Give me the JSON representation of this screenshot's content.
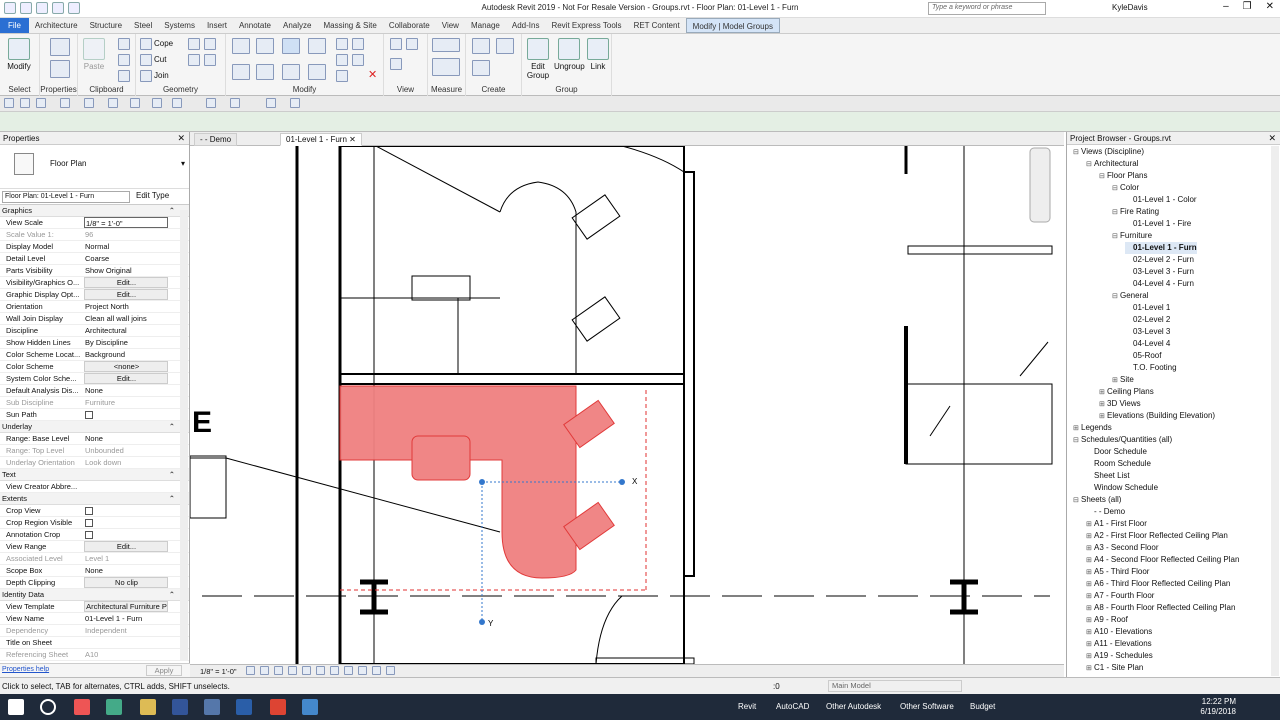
{
  "window": {
    "title": "Autodesk Revit 2019 - Not For Resale Version - Groups.rvt - Floor Plan: 01-Level 1 - Furn",
    "search_placeholder": "Type a keyword or phrase",
    "user": "KyleDavis"
  },
  "ribbon_tabs": [
    "File",
    "Architecture",
    "Structure",
    "Steel",
    "Systems",
    "Insert",
    "Annotate",
    "Analyze",
    "Massing & Site",
    "Collaborate",
    "View",
    "Manage",
    "Add-Ins",
    "Revit Express Tools",
    "RET Content",
    "Modify | Model Groups"
  ],
  "ribbon": {
    "modify_label": "Modify",
    "paste_label": "Paste",
    "cope_label": "Cope",
    "cut_label": "Cut",
    "join_label": "Join",
    "edit_group_label": "Edit Group",
    "ungroup_label": "Ungroup",
    "link_label": "Link",
    "panels": [
      "Select",
      "Properties",
      "Clipboard",
      "Geometry",
      "Modify",
      "View",
      "Measure",
      "Create",
      "Group"
    ]
  },
  "properties": {
    "header": "Properties",
    "type_name": "Floor Plan",
    "selector": "Floor Plan: 01-Level 1 - Furn",
    "edit_type": "Edit Type",
    "rows": [
      {
        "kind": "section",
        "label": "Graphics"
      },
      {
        "k": "View Scale",
        "v": "1/8\" = 1'-0\"",
        "style": "input"
      },
      {
        "k": "Scale Value   1:",
        "v": "96",
        "style": "grey"
      },
      {
        "k": "Display Model",
        "v": "Normal"
      },
      {
        "k": "Detail Level",
        "v": "Coarse"
      },
      {
        "k": "Parts Visibility",
        "v": "Show Original"
      },
      {
        "k": "Visibility/Graphics O...",
        "v": "Edit...",
        "style": "btn"
      },
      {
        "k": "Graphic Display Opt...",
        "v": "Edit...",
        "style": "btn"
      },
      {
        "k": "Orientation",
        "v": "Project North"
      },
      {
        "k": "Wall Join Display",
        "v": "Clean all wall joins"
      },
      {
        "k": "Discipline",
        "v": "Architectural"
      },
      {
        "k": "Show Hidden Lines",
        "v": "By Discipline"
      },
      {
        "k": "Color Scheme Locat...",
        "v": "Background"
      },
      {
        "k": "Color Scheme",
        "v": "<none>",
        "style": "btn"
      },
      {
        "k": "System Color Sche...",
        "v": "Edit...",
        "style": "btn"
      },
      {
        "k": "Default Analysis Dis...",
        "v": "None"
      },
      {
        "k": "Sub Discipline",
        "v": "Furniture",
        "style": "grey"
      },
      {
        "k": "Sun Path",
        "v": "",
        "style": "check"
      },
      {
        "kind": "section",
        "label": "Underlay"
      },
      {
        "k": "Range: Base Level",
        "v": "None"
      },
      {
        "k": "Range: Top Level",
        "v": "Unbounded",
        "style": "grey"
      },
      {
        "k": "Underlay Orientation",
        "v": "Look down",
        "style": "grey"
      },
      {
        "kind": "section",
        "label": "Text"
      },
      {
        "k": "View Creator Abbre...",
        "v": ""
      },
      {
        "kind": "section",
        "label": "Extents"
      },
      {
        "k": "Crop View",
        "v": "",
        "style": "check"
      },
      {
        "k": "Crop Region Visible",
        "v": "",
        "style": "check"
      },
      {
        "k": "Annotation Crop",
        "v": "",
        "style": "check"
      },
      {
        "k": "View Range",
        "v": "Edit...",
        "style": "btn"
      },
      {
        "k": "Associated Level",
        "v": "Level 1",
        "style": "grey"
      },
      {
        "k": "Scope Box",
        "v": "None"
      },
      {
        "k": "Depth Clipping",
        "v": "No clip",
        "style": "btn"
      },
      {
        "kind": "section",
        "label": "Identity Data"
      },
      {
        "k": "View Template",
        "v": "Architectural Furniture P",
        "style": "btn"
      },
      {
        "k": "View Name",
        "v": "01-Level 1 - Furn"
      },
      {
        "k": "Dependency",
        "v": "Independent",
        "style": "grey"
      },
      {
        "k": "Title on Sheet",
        "v": ""
      },
      {
        "k": "Referencing Sheet",
        "v": "A10",
        "style": "grey"
      }
    ],
    "help_link": "Properties help",
    "apply": "Apply"
  },
  "view_tabs": [
    {
      "label": "- - Demo",
      "active": false
    },
    {
      "label": "01-Level 1 - Furn",
      "active": true
    }
  ],
  "canvas": {
    "x_label": "X",
    "y_label": "Y",
    "e_label": "E"
  },
  "view_control": {
    "scale": "1/8\" = 1'-0\""
  },
  "browser": {
    "header": "Project Browser - Groups.rvt",
    "items": [
      {
        "label": "Views (Discipline)",
        "indent": 0,
        "tw": "⊟"
      },
      {
        "label": "Architectural",
        "indent": 1,
        "tw": "⊟"
      },
      {
        "label": "Floor Plans",
        "indent": 2,
        "tw": "⊟"
      },
      {
        "label": "Color",
        "indent": 3,
        "tw": "⊟"
      },
      {
        "label": "01-Level 1 - Color",
        "indent": 4,
        "tw": ""
      },
      {
        "label": "Fire Rating",
        "indent": 3,
        "tw": "⊟"
      },
      {
        "label": "01-Level 1 - Fire",
        "indent": 4,
        "tw": ""
      },
      {
        "label": "Furniture",
        "indent": 3,
        "tw": "⊟"
      },
      {
        "label": "01-Level 1 - Furn",
        "indent": 4,
        "tw": "",
        "bold": true
      },
      {
        "label": "02-Level 2 - Furn",
        "indent": 4,
        "tw": ""
      },
      {
        "label": "03-Level 3 - Furn",
        "indent": 4,
        "tw": ""
      },
      {
        "label": "04-Level 4 - Furn",
        "indent": 4,
        "tw": ""
      },
      {
        "label": "General",
        "indent": 3,
        "tw": "⊟"
      },
      {
        "label": "01-Level 1",
        "indent": 4,
        "tw": ""
      },
      {
        "label": "02-Level 2",
        "indent": 4,
        "tw": ""
      },
      {
        "label": "03-Level 3",
        "indent": 4,
        "tw": ""
      },
      {
        "label": "04-Level 4",
        "indent": 4,
        "tw": ""
      },
      {
        "label": "05-Roof",
        "indent": 4,
        "tw": ""
      },
      {
        "label": "T.O. Footing",
        "indent": 4,
        "tw": ""
      },
      {
        "label": "Site",
        "indent": 3,
        "tw": "⊞"
      },
      {
        "label": "Ceiling Plans",
        "indent": 2,
        "tw": "⊞"
      },
      {
        "label": "3D Views",
        "indent": 2,
        "tw": "⊞"
      },
      {
        "label": "Elevations (Building Elevation)",
        "indent": 2,
        "tw": "⊞"
      },
      {
        "label": "Legends",
        "indent": 0,
        "tw": "⊞"
      },
      {
        "label": "Schedules/Quantities (all)",
        "indent": 0,
        "tw": "⊟"
      },
      {
        "label": "Door Schedule",
        "indent": 1,
        "tw": ""
      },
      {
        "label": "Room Schedule",
        "indent": 1,
        "tw": ""
      },
      {
        "label": "Sheet List",
        "indent": 1,
        "tw": ""
      },
      {
        "label": "Window Schedule",
        "indent": 1,
        "tw": ""
      },
      {
        "label": "Sheets (all)",
        "indent": 0,
        "tw": "⊟"
      },
      {
        "label": "- - Demo",
        "indent": 1,
        "tw": ""
      },
      {
        "label": "A1 - First Floor",
        "indent": 1,
        "tw": "⊞"
      },
      {
        "label": "A2 - First Floor Reflected Ceiling Plan",
        "indent": 1,
        "tw": "⊞"
      },
      {
        "label": "A3 - Second Floor",
        "indent": 1,
        "tw": "⊞"
      },
      {
        "label": "A4 - Second Floor Reflected Ceiling Plan",
        "indent": 1,
        "tw": "⊞"
      },
      {
        "label": "A5 - Third Floor",
        "indent": 1,
        "tw": "⊞"
      },
      {
        "label": "A6 - Third Floor Reflected Ceiling Plan",
        "indent": 1,
        "tw": "⊞"
      },
      {
        "label": "A7 - Fourth Floor",
        "indent": 1,
        "tw": "⊞"
      },
      {
        "label": "A8 - Fourth Floor Reflected Ceiling Plan",
        "indent": 1,
        "tw": "⊞"
      },
      {
        "label": "A9 - Roof",
        "indent": 1,
        "tw": "⊞"
      },
      {
        "label": "A10 - Elevations",
        "indent": 1,
        "tw": "⊞"
      },
      {
        "label": "A11 - Elevations",
        "indent": 1,
        "tw": "⊞"
      },
      {
        "label": "A19 - Schedules",
        "indent": 1,
        "tw": "⊞"
      },
      {
        "label": "C1 - Site Plan",
        "indent": 1,
        "tw": "⊞"
      }
    ]
  },
  "status": {
    "message": "Click to select, TAB for alternates, CTRL adds, SHIFT unselects.",
    "zero": ":0",
    "model": "Main Model"
  },
  "taskbar": {
    "apps": [
      "Revit",
      "AutoCAD",
      "Other Autodesk",
      "Other Software",
      "Budget"
    ],
    "time": "12:22 PM",
    "date": "6/19/2018"
  },
  "colors": {
    "accent": "#2b6fd3",
    "selection": "#f08080",
    "selection_stroke": "#e03030"
  }
}
